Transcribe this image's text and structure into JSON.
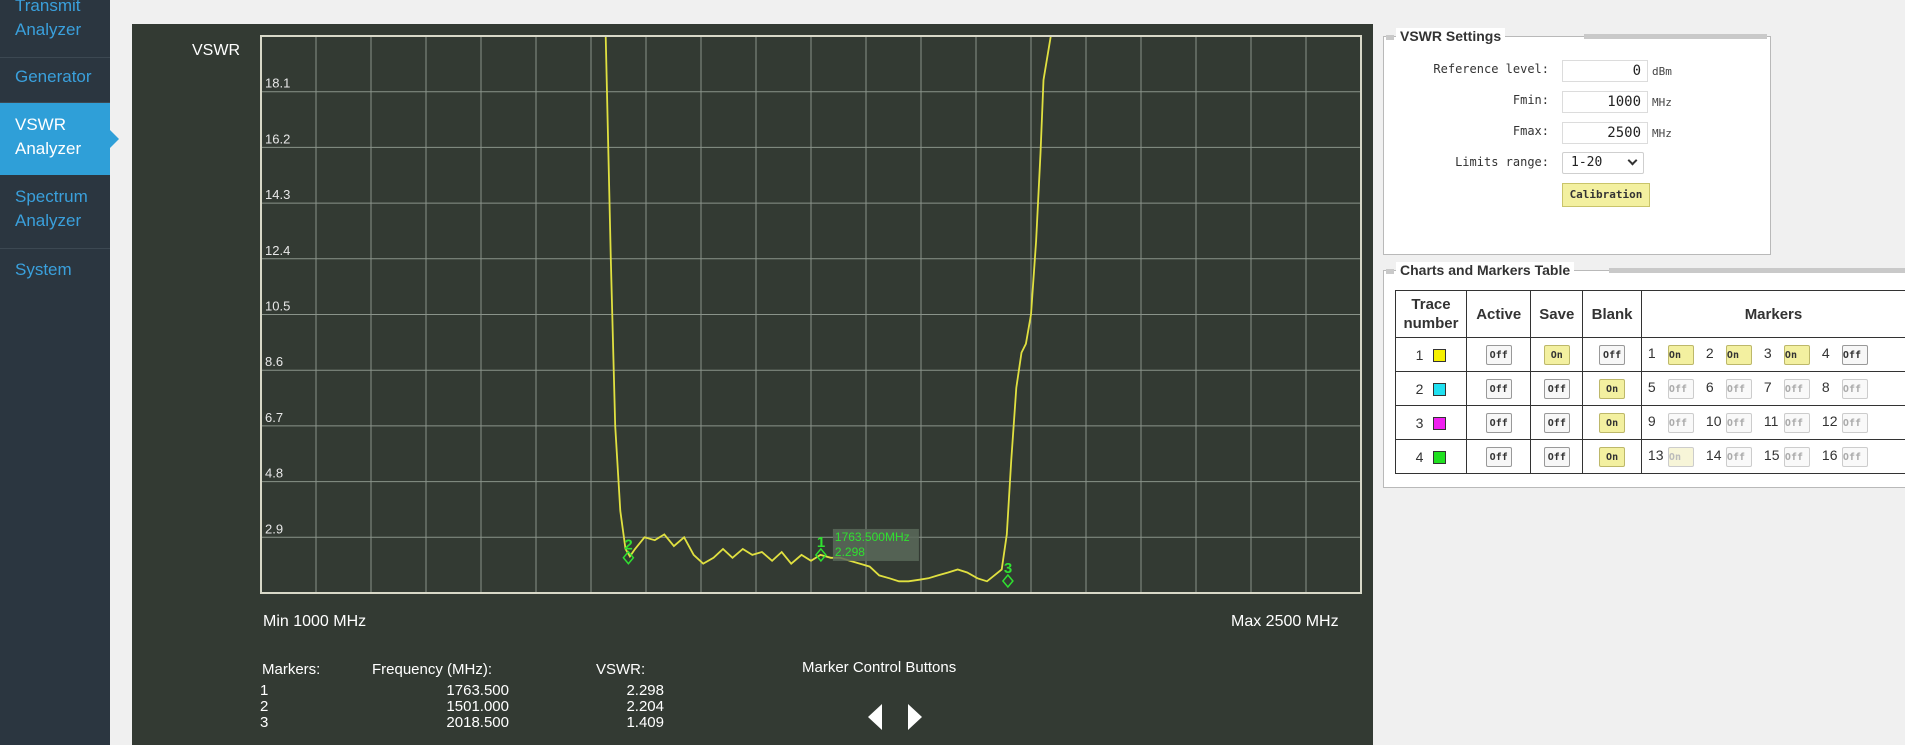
{
  "nav": [
    {
      "label": "Transmit Analyzer",
      "active": false
    },
    {
      "label": "Generator",
      "active": false
    },
    {
      "label": "VSWR Analyzer",
      "active": true
    },
    {
      "label": "Spectrum Analyzer",
      "active": false
    },
    {
      "label": "System",
      "active": false
    }
  ],
  "chart": {
    "y_title": "VSWR",
    "min_label": "Min 1000 MHz",
    "max_label": "Max 2500 MHz",
    "tooltip_freq": "1763.500MHz",
    "tooltip_val": "2.298",
    "marker_labels": [
      "1",
      "2",
      "3"
    ]
  },
  "readout": {
    "markers_header": "Markers:",
    "freq_header": "Frequency (MHz):",
    "vswr_header": "VSWR:",
    "control_title": "Marker Control Buttons",
    "rows": [
      {
        "n": "1",
        "freq": "1763.500",
        "vswr": "2.298"
      },
      {
        "n": "2",
        "freq": "1501.000",
        "vswr": "2.204"
      },
      {
        "n": "3",
        "freq": "2018.500",
        "vswr": "1.409"
      }
    ]
  },
  "chart_data": {
    "type": "line",
    "title": "",
    "ylabel": "VSWR",
    "xlabel": "",
    "xlim": [
      1000,
      2500
    ],
    "ylim": [
      1,
      20
    ],
    "yticks": [
      2.9,
      4.8,
      6.7,
      8.6,
      10.5,
      12.4,
      14.3,
      16.2,
      18.1
    ],
    "ytick_labels": [
      "2.9",
      "4.8",
      "6.7",
      "8.6",
      "10.5",
      "12.4",
      "14.3",
      "16.2",
      "18.1"
    ],
    "grid": true,
    "series": [
      {
        "color": "#e0e040",
        "x": [
          1000,
          1470,
          1477,
          1483,
          1490,
          1497,
          1503,
          1510,
          1523,
          1537,
          1550,
          1563,
          1577,
          1590,
          1603,
          1617,
          1630,
          1643,
          1657,
          1670,
          1683,
          1697,
          1710,
          1723,
          1737,
          1750,
          1763,
          1777,
          1790,
          1803,
          1817,
          1830,
          1843,
          1857,
          1870,
          1883,
          1897,
          1910,
          1923,
          1937,
          1950,
          1963,
          1977,
          1990,
          2000,
          2010,
          2017,
          2023,
          2030,
          2037,
          2043,
          2050,
          2057,
          2063,
          2067,
          2077,
          2083,
          2500
        ],
        "values": [
          20,
          20,
          12.4,
          6.7,
          3.8,
          2.5,
          2.25,
          2.5,
          2.9,
          2.8,
          3.0,
          2.6,
          2.9,
          2.3,
          2.0,
          2.2,
          2.5,
          2.2,
          2.5,
          2.3,
          2.4,
          2.1,
          2.4,
          2.0,
          2.3,
          2.1,
          2.3,
          2.2,
          2.2,
          2.1,
          2.0,
          1.9,
          1.6,
          1.5,
          1.4,
          1.4,
          1.45,
          1.5,
          1.6,
          1.7,
          1.8,
          1.7,
          1.5,
          1.4,
          1.6,
          1.8,
          3.0,
          5.5,
          8.0,
          9.2,
          9.5,
          10.5,
          13.0,
          16.0,
          18.5,
          20,
          20,
          20
        ]
      }
    ],
    "markers": [
      {
        "n": "1",
        "x": 1763.5,
        "y": 2.298
      },
      {
        "n": "2",
        "x": 1501.0,
        "y": 2.204
      },
      {
        "n": "3",
        "x": 2018.5,
        "y": 1.409
      }
    ]
  },
  "vswr_settings": {
    "title": "VSWR Settings",
    "ref_label": "Reference level:",
    "ref_value": "0",
    "ref_unit": "dBm",
    "fmin_label": "Fmin:",
    "fmin_value": "1000",
    "fmin_unit": "MHz",
    "fmax_label": "Fmax:",
    "fmax_value": "2500",
    "fmax_unit": "MHz",
    "limits_label": "Limits range:",
    "limits_value": "1-20",
    "calibration_label": "Calibration"
  },
  "markers_table": {
    "title": "Charts and Markers Table",
    "headers": {
      "trace": "Trace number",
      "active": "Active",
      "save": "Save",
      "blank": "Blank",
      "markers": "Markers"
    },
    "rows": [
      {
        "trace": "1",
        "color": "#f5f000",
        "active": "Off",
        "save": "On",
        "blank": "Off",
        "markers": [
          {
            "n": "1",
            "state": "On"
          },
          {
            "n": "2",
            "state": "On"
          },
          {
            "n": "3",
            "state": "On"
          },
          {
            "n": "4",
            "state": "Off"
          }
        ]
      },
      {
        "trace": "2",
        "color": "#20e0f0",
        "active": "Off",
        "save": "Off",
        "blank": "On",
        "markers": [
          {
            "n": "5",
            "state": "Off"
          },
          {
            "n": "6",
            "state": "Off"
          },
          {
            "n": "7",
            "state": "Off"
          },
          {
            "n": "8",
            "state": "Off"
          }
        ]
      },
      {
        "trace": "3",
        "color": "#f020f0",
        "active": "Off",
        "save": "Off",
        "blank": "On",
        "markers": [
          {
            "n": "9",
            "state": "Off"
          },
          {
            "n": "10",
            "state": "Off"
          },
          {
            "n": "11",
            "state": "Off"
          },
          {
            "n": "12",
            "state": "Off"
          }
        ]
      },
      {
        "trace": "4",
        "color": "#20e020",
        "active": "Off",
        "save": "Off",
        "blank": "On",
        "markers": [
          {
            "n": "13",
            "state": "On"
          },
          {
            "n": "14",
            "state": "Off"
          },
          {
            "n": "15",
            "state": "Off"
          },
          {
            "n": "16",
            "state": "Off"
          }
        ]
      }
    ]
  }
}
